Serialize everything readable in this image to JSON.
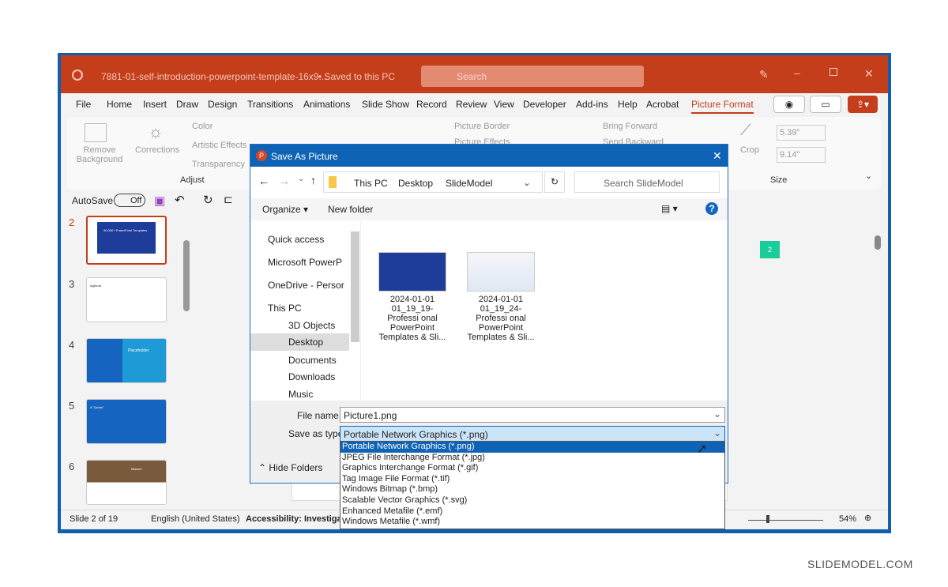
{
  "app": {
    "title": "7881-01-self-introduction-powerpoint-template-16x9....",
    "saved": "• Saved to this PC",
    "search_placeholder": "Search",
    "brand_color": "#c43e1c"
  },
  "menu": [
    "File",
    "Home",
    "Insert",
    "Draw",
    "Design",
    "Transitions",
    "Animations",
    "Slide Show",
    "Record",
    "Review",
    "View",
    "Developer",
    "Add-ins",
    "Help",
    "Acrobat",
    "Picture Format"
  ],
  "ribbon": {
    "remove_background": "Remove Background",
    "corrections": "Corrections",
    "color": "Color",
    "artistic": "Artistic Effects",
    "transparency": "Transparency",
    "adjust": "Adjust",
    "picture_border": "Picture Border",
    "picture_effects": "Picture Effects",
    "bring_forward": "Bring Forward",
    "send_backward": "Send Backward",
    "crop": "Crop",
    "height": "5.39\"",
    "width": "9.14\"",
    "size": "Size"
  },
  "qat": {
    "autosave": "AutoSave",
    "toggle": "Off"
  },
  "slides": [
    {
      "n": "2",
      "label": "50,000+ PowerPoint Templates"
    },
    {
      "n": "3",
      "label": "Agenda"
    },
    {
      "n": "4",
      "label": "Placeholder"
    },
    {
      "n": "5",
      "label": "A \"Quote\""
    },
    {
      "n": "6",
      "label": "Mission"
    }
  ],
  "slide_badge": "2",
  "status": {
    "slide": "Slide 2 of 19",
    "language": "English (United States)",
    "accessibility": "Accessibility: Investigate",
    "zoom": "54%"
  },
  "dialog": {
    "title": "Save As Picture",
    "breadcrumb": [
      "This PC",
      "Desktop",
      "SlideModel"
    ],
    "search_placeholder": "Search SlideModel",
    "organize": "Organize ▾",
    "new_folder": "New folder",
    "nav": [
      "Quick access",
      "Microsoft PowerP",
      "OneDrive - Persor",
      "This PC",
      "3D Objects",
      "Desktop",
      "Documents",
      "Downloads",
      "Music"
    ],
    "files": [
      {
        "name": "2024-01-01 01_19_19-Professi onal PowerPoint Templates & Sli..."
      },
      {
        "name": "2024-01-01 01_19_24-Professi onal PowerPoint Templates & Sli..."
      }
    ],
    "file_name_label": "File name:",
    "file_name": "Picture1.png",
    "type_label": "Save as type:",
    "type": "Portable Network Graphics (*.png)",
    "hide_folders": "Hide Folders",
    "options": [
      "Portable Network Graphics (*.png)",
      "JPEG File Interchange Format (*.jpg)",
      "Graphics Interchange Format (*.gif)",
      "Tag Image File Format (*.tif)",
      "Windows Bitmap (*.bmp)",
      "Scalable Vector Graphics (*.svg)",
      "Enhanced Metafile (*.emf)",
      "Windows Metafile (*.wmf)"
    ]
  },
  "watermark": "SLIDEMODEL.COM"
}
